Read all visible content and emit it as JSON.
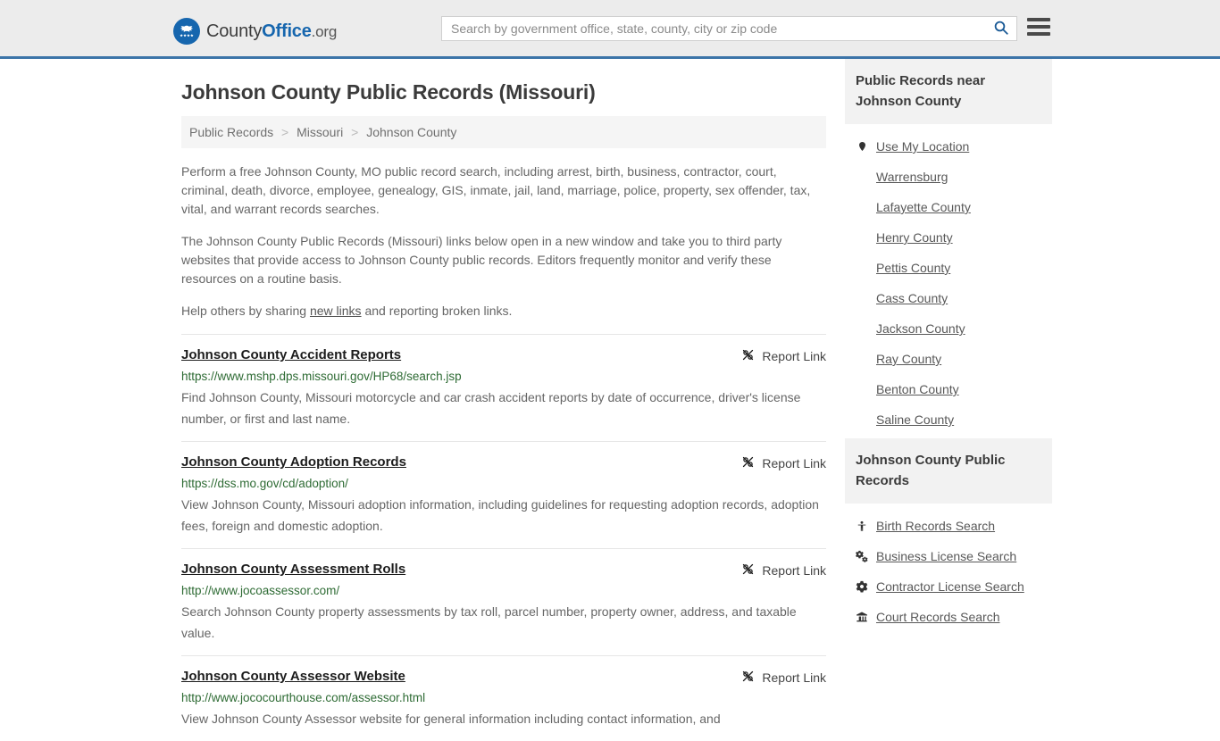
{
  "header": {
    "logo": {
      "prefix": "County",
      "bold": "Office",
      "suffix": ".org",
      "icon": "eagle-seal-icon"
    },
    "search": {
      "placeholder": "Search by government office, state, county, city or zip code",
      "value": "",
      "icon": "search-icon"
    },
    "menu_icon": "hamburger-menu-icon",
    "accent_color": "#3c74a8",
    "background_color": "#ececec"
  },
  "main": {
    "title": "Johnson County Public Records (Missouri)",
    "breadcrumb": [
      {
        "label": "Public Records"
      },
      {
        "label": "Missouri"
      },
      {
        "label": "Johnson County"
      }
    ],
    "breadcrumb_separator": ">",
    "intro": [
      "Perform a free Johnson County, MO public record search, including arrest, birth, business, contractor, court, criminal, death, divorce, employee, genealogy, GIS, inmate, jail, land, marriage, police, property, sex offender, tax, vital, and warrant records searches.",
      "The Johnson County Public Records (Missouri) links below open in a new window and take you to third party websites that provide access to Johnson County public records. Editors frequently monitor and verify these resources on a routine basis."
    ],
    "help_line": {
      "before": "Help others by sharing ",
      "link": "new links",
      "after": " and reporting broken links."
    },
    "report_link_label": "Report Link",
    "report_link_icon": "broken-chain-icon",
    "url_color": "#2e6b34",
    "results": [
      {
        "title": "Johnson County Accident Reports",
        "url": "https://www.mshp.dps.missouri.gov/HP68/search.jsp",
        "description": "Find Johnson County, Missouri motorcycle and car crash accident reports by date of occurrence, driver's license number, or first and last name."
      },
      {
        "title": "Johnson County Adoption Records",
        "url": "https://dss.mo.gov/cd/adoption/",
        "description": "View Johnson County, Missouri adoption information, including guidelines for requesting adoption records, adoption fees, foreign and domestic adoption."
      },
      {
        "title": "Johnson County Assessment Rolls",
        "url": "http://www.jocoassessor.com/",
        "description": "Search Johnson County property assessments by tax roll, parcel number, property owner, address, and taxable value."
      },
      {
        "title": "Johnson County Assessor Website",
        "url": "http://www.jococourthouse.com/assessor.html",
        "description": "View Johnson County Assessor website for general information including contact information, and"
      }
    ]
  },
  "sidebar": {
    "nearby": {
      "heading": "Public Records near Johnson County",
      "items": [
        {
          "label": "Use My Location",
          "icon": "map-pin-icon"
        },
        {
          "label": "Warrensburg",
          "icon": ""
        },
        {
          "label": "Lafayette County",
          "icon": ""
        },
        {
          "label": "Henry County",
          "icon": ""
        },
        {
          "label": "Pettis County",
          "icon": ""
        },
        {
          "label": "Cass County",
          "icon": ""
        },
        {
          "label": "Jackson County",
          "icon": ""
        },
        {
          "label": "Ray County",
          "icon": ""
        },
        {
          "label": "Benton County",
          "icon": ""
        },
        {
          "label": "Saline County",
          "icon": ""
        }
      ]
    },
    "records": {
      "heading": "Johnson County Public Records",
      "items": [
        {
          "label": "Birth Records Search",
          "icon": "baby-icon"
        },
        {
          "label": "Business License Search",
          "icon": "cogs-icon"
        },
        {
          "label": "Contractor License Search",
          "icon": "gear-icon"
        },
        {
          "label": "Court Records Search",
          "icon": "courthouse-icon"
        }
      ]
    }
  }
}
